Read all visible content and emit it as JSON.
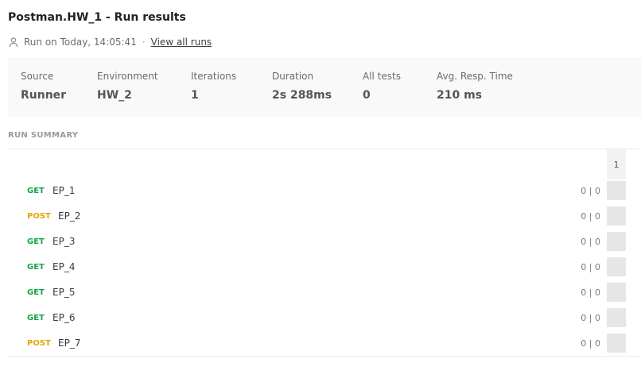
{
  "header": {
    "title": "Postman.HW_1 - Run results",
    "run_text": "Run on Today, 14:05:41",
    "separator": "·",
    "view_all_link": "View all runs",
    "user_icon": "user-icon"
  },
  "stats": [
    {
      "label": "Source",
      "value": "Runner"
    },
    {
      "label": "Environment",
      "value": "HW_2"
    },
    {
      "label": "Iterations",
      "value": "1"
    },
    {
      "label": "Duration",
      "value": "2s 288ms"
    },
    {
      "label": "All tests",
      "value": "0"
    },
    {
      "label": "Avg. Resp. Time",
      "value": "210 ms"
    }
  ],
  "summary": {
    "label": "RUN SUMMARY",
    "iteration_header": "1",
    "requests": [
      {
        "method": "GET",
        "name": "EP_1",
        "counts": "0 | 0"
      },
      {
        "method": "POST",
        "name": "EP_2",
        "counts": "0 | 0"
      },
      {
        "method": "GET",
        "name": "EP_3",
        "counts": "0 | 0"
      },
      {
        "method": "GET",
        "name": "EP_4",
        "counts": "0 | 0"
      },
      {
        "method": "GET",
        "name": "EP_5",
        "counts": "0 | 0"
      },
      {
        "method": "GET",
        "name": "EP_6",
        "counts": "0 | 0"
      },
      {
        "method": "POST",
        "name": "EP_7",
        "counts": "0 | 0"
      }
    ]
  },
  "colors": {
    "get": "#16a34a",
    "post": "#e0a800",
    "stats_bg": "#f9f9f9",
    "iteration_cell": "#e6e6e6"
  }
}
